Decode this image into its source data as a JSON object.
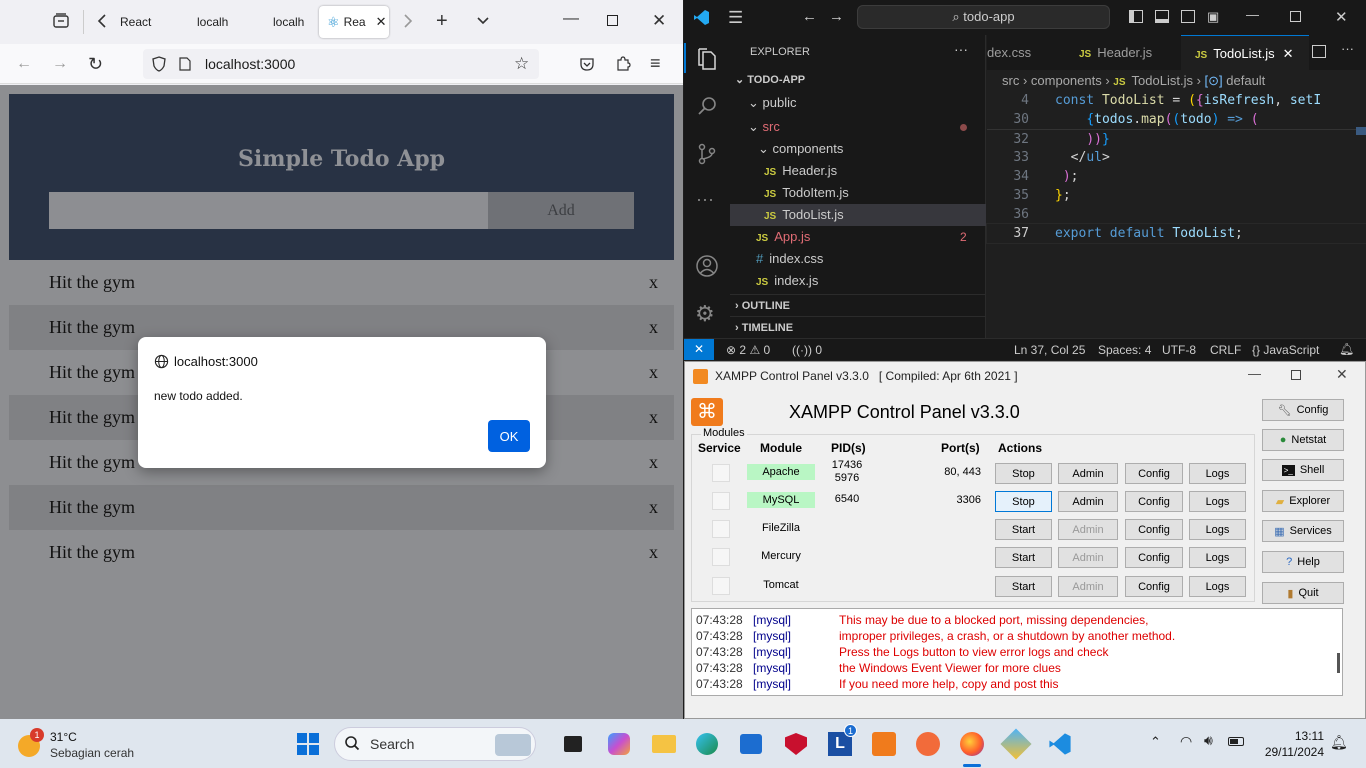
{
  "browser": {
    "tabs": [
      {
        "label": "React"
      },
      {
        "label": "localh"
      },
      {
        "label": "localh"
      },
      {
        "label": "Rea"
      }
    ],
    "url": "localhost:3000"
  },
  "todo_app": {
    "title": "Simple Todo App",
    "input_value": "",
    "add_label": "Add",
    "items": [
      {
        "text": "Hit the gym",
        "delete": "x"
      },
      {
        "text": "Hit the gym",
        "delete": "x"
      },
      {
        "text": "Hit the gym",
        "delete": "x"
      },
      {
        "text": "Hit the gym",
        "delete": "x"
      },
      {
        "text": "Hit the gym",
        "delete": "x"
      },
      {
        "text": "Hit the gym",
        "delete": "x"
      },
      {
        "text": "Hit the gym",
        "delete": "x"
      }
    ]
  },
  "alert": {
    "origin": "localhost:3000",
    "message": "new todo added.",
    "ok": "OK"
  },
  "vscode": {
    "command_center": "todo-app",
    "explorer_title": "EXPLORER",
    "tree": [
      {
        "label": "TODO-APP"
      },
      {
        "label": "public"
      },
      {
        "label": "src"
      },
      {
        "label": "components"
      },
      {
        "label": "Header.js"
      },
      {
        "label": "TodoItem.js"
      },
      {
        "label": "TodoList.js"
      },
      {
        "label": "App.js",
        "badge": "2"
      },
      {
        "label": "index.css"
      },
      {
        "label": "index.js"
      },
      {
        "label": "OUTLINE"
      },
      {
        "label": "TIMELINE"
      }
    ],
    "editor_tabs": [
      {
        "label": "dex.css"
      },
      {
        "label": "Header.js"
      },
      {
        "label": "TodoList.js"
      }
    ],
    "breadcrumbs": [
      "src",
      "components",
      "TodoList.js",
      "default"
    ],
    "line_numbers": [
      "4",
      "30",
      "32",
      "33",
      "34",
      "35",
      "36",
      "37"
    ],
    "status": {
      "errors": "2",
      "warnings": "0",
      "ports": "0",
      "position": "Ln 37, Col 25",
      "spaces": "Spaces: 4",
      "encoding": "UTF-8",
      "eol": "CRLF",
      "language": "JavaScript"
    }
  },
  "xampp": {
    "window_title": "XAMPP Control Panel v3.3.0   [ Compiled: Apr 6th 2021 ]",
    "heading": "XAMPP Control Panel v3.3.0",
    "modules_label": "Modules",
    "headers": {
      "service": "Service",
      "module": "Module",
      "pid": "PID(s)",
      "port": "Port(s)",
      "actions": "Actions"
    },
    "modules": [
      {
        "name": "Apache",
        "pid": "17436\n5976",
        "port": "80, 443",
        "action": "Stop",
        "admin": "Admin",
        "config": "Config",
        "logs": "Logs",
        "running": true
      },
      {
        "name": "MySQL",
        "pid": "6540",
        "port": "3306",
        "action": "Stop",
        "admin": "Admin",
        "config": "Config",
        "logs": "Logs",
        "running": true
      },
      {
        "name": "FileZilla",
        "pid": "",
        "port": "",
        "action": "Start",
        "admin": "Admin",
        "config": "Config",
        "logs": "Logs",
        "running": false
      },
      {
        "name": "Mercury",
        "pid": "",
        "port": "",
        "action": "Start",
        "admin": "Admin",
        "config": "Config",
        "logs": "Logs",
        "running": false
      },
      {
        "name": "Tomcat",
        "pid": "",
        "port": "",
        "action": "Start",
        "admin": "Admin",
        "config": "Config",
        "logs": "Logs",
        "running": false
      }
    ],
    "side_buttons": [
      "Config",
      "Netstat",
      "Shell",
      "Explorer",
      "Services",
      "Help",
      "Quit"
    ],
    "log": [
      {
        "time": "07:43:28",
        "module": "[mysql]",
        "msg": "This may be due to a blocked port, missing dependencies,"
      },
      {
        "time": "07:43:28",
        "module": "[mysql]",
        "msg": "improper privileges, a crash, or a shutdown by another method."
      },
      {
        "time": "07:43:28",
        "module": "[mysql]",
        "msg": "Press the Logs button to view error logs and check"
      },
      {
        "time": "07:43:28",
        "module": "[mysql]",
        "msg": "the Windows Event Viewer for more clues"
      },
      {
        "time": "07:43:28",
        "module": "[mysql]",
        "msg": "If you need more help, copy and post this"
      }
    ]
  },
  "taskbar": {
    "weather_temp": "31°C",
    "weather_desc": "Sebagian cerah",
    "weather_badge": "1",
    "search_placeholder": "Search",
    "time": "13:11",
    "date": "29/11/2024"
  }
}
